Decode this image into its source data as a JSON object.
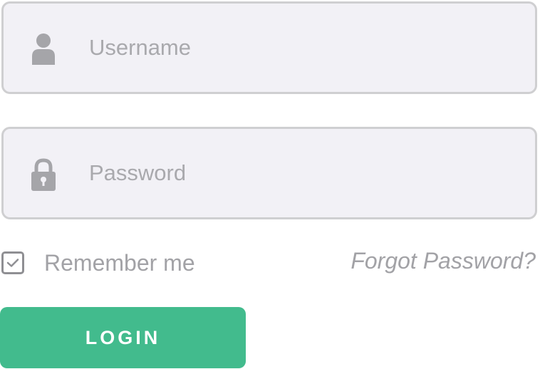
{
  "colors": {
    "field_background": "#f2f1f6",
    "field_border": "#cfcfd1",
    "icon": "#a5a5a9",
    "placeholder": "#a9a9ad",
    "checkbox_border": "#8f8f93",
    "muted_text": "#a2a2a6",
    "login_button": "#42bb8d",
    "login_text": "#ffffff"
  },
  "username": {
    "icon": "user-icon",
    "placeholder": "Username",
    "value": ""
  },
  "password": {
    "icon": "lock-icon",
    "placeholder": "Password",
    "value": ""
  },
  "remember": {
    "label": "Remember me",
    "checked": true,
    "icon": "checkmark-icon"
  },
  "forgot_password": {
    "label": "Forgot Password?"
  },
  "login_button": {
    "label": "LOGIN"
  }
}
